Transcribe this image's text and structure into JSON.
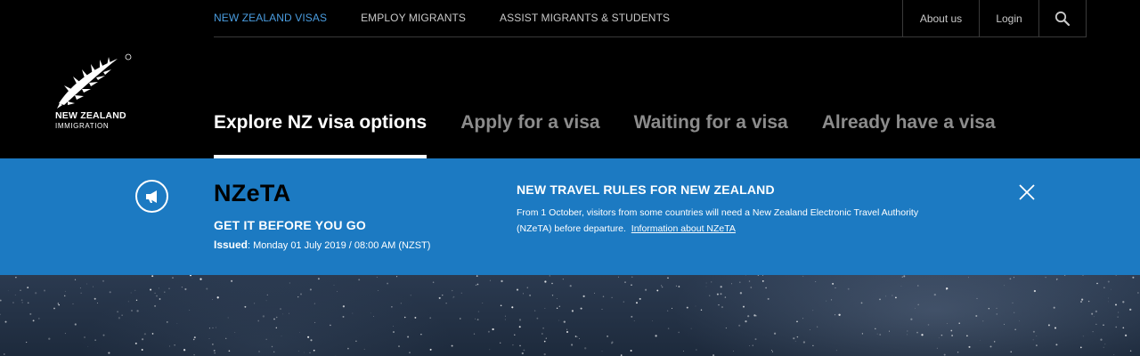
{
  "logo": {
    "title": "NEW ZEALAND",
    "subtitle": "IMMIGRATION",
    "icon": "silver-fern-icon"
  },
  "top_nav": [
    {
      "label": "NEW ZEALAND VISAS",
      "active": true
    },
    {
      "label": "EMPLOY MIGRANTS",
      "active": false
    },
    {
      "label": "ASSIST MIGRANTS & STUDENTS",
      "active": false
    }
  ],
  "utility": {
    "about": "About us",
    "login": "Login",
    "search_icon": "search-icon"
  },
  "main_nav": [
    {
      "label": "Explore NZ visa options",
      "active": true
    },
    {
      "label": "Apply for a visa",
      "active": false
    },
    {
      "label": "Waiting for a visa",
      "active": false
    },
    {
      "label": "Already have a visa",
      "active": false
    }
  ],
  "alert": {
    "icon": "megaphone-icon",
    "title": "NZeTA",
    "subtitle": "GET IT BEFORE YOU GO",
    "issued_label": "Issued",
    "issued_value": ": Monday 01 July 2019 / 08:00 AM (NZST)",
    "notice_title": "NEW TRAVEL RULES FOR NEW ZEALAND",
    "notice_body": "From 1 October, visitors from some countries will need a New Zealand Electronic Travel Authority (NZeTA) before departure.",
    "notice_link": "Information about NZeTA",
    "close_icon": "close-icon"
  },
  "colors": {
    "background": "#000000",
    "active_nav": "#4a9de0",
    "banner": "#1c7ac2",
    "inactive_tab": "#8c8c8c"
  }
}
